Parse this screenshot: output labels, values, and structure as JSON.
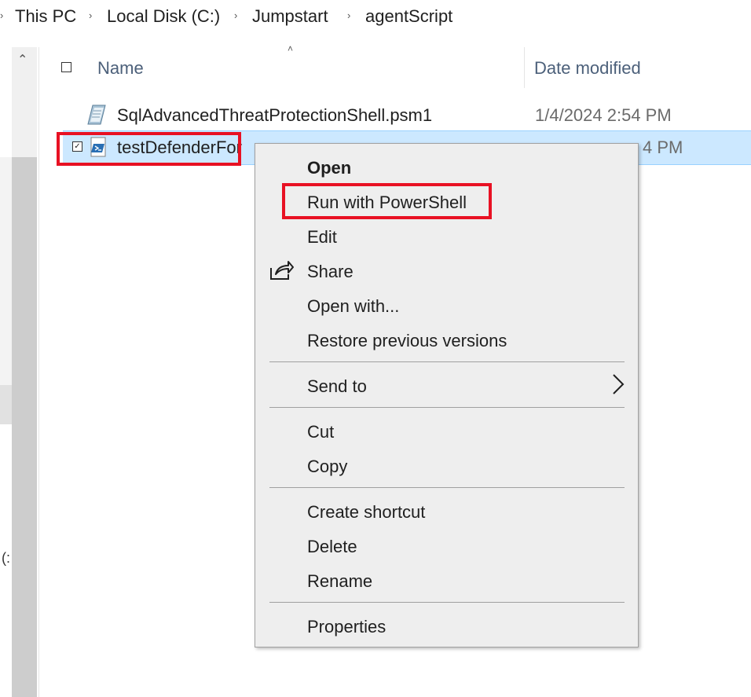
{
  "breadcrumb": {
    "items": [
      "This PC",
      "Local Disk (C:)",
      "Jumpstart",
      "agentScript"
    ]
  },
  "nav": {
    "partial_glyph": "(:"
  },
  "header": {
    "name_label": "Name",
    "date_label": "Date modified"
  },
  "files": [
    {
      "name": "SqlAdvancedThreatProtectionShell.psm1",
      "date": "1/4/2024 2:54 PM",
      "icon": "powershell-module-icon"
    },
    {
      "name": "testDefenderFor",
      "date": "4 PM",
      "icon": "powershell-script-icon",
      "selected": true
    }
  ],
  "context_menu": {
    "items": {
      "open": "Open",
      "run_with_powershell": "Run with PowerShell",
      "edit": "Edit",
      "share": "Share",
      "open_with": "Open with...",
      "restore_previous_versions": "Restore previous versions",
      "send_to": "Send to",
      "cut": "Cut",
      "copy": "Copy",
      "create_shortcut": "Create shortcut",
      "delete": "Delete",
      "rename": "Rename",
      "properties": "Properties"
    }
  },
  "colors": {
    "selection": "#cce8ff",
    "highlight": "#e81123",
    "menu_background": "#eeeeee",
    "header_text": "#4c607a"
  }
}
